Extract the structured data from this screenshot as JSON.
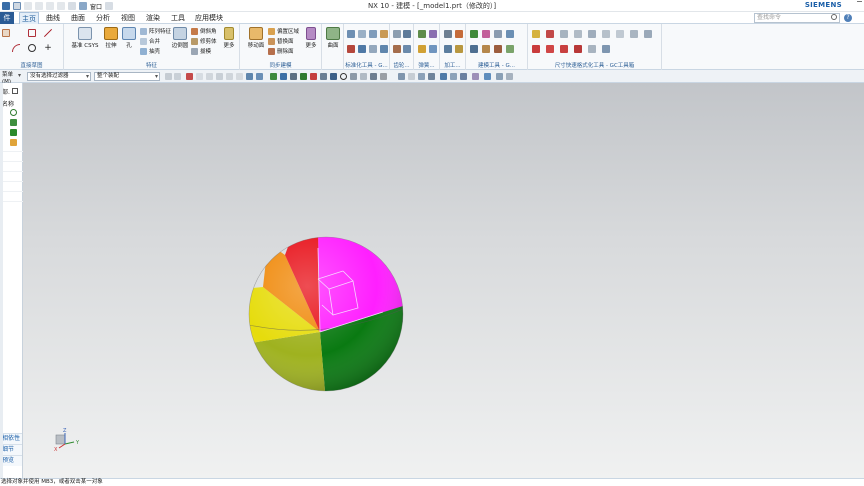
{
  "title": "NX 10 - 建模 - [_model1.prt（修改的）]",
  "brand": "SIEMENS",
  "file_tab": "件(F)",
  "menu_tabs": [
    "主页",
    "曲线",
    "曲面",
    "分析",
    "视图",
    "渲染",
    "工具",
    "应用模块"
  ],
  "active_tab": "主页",
  "search_placeholder": "查找命令",
  "quick_access": {
    "window_label": "窗口"
  },
  "ribbon": {
    "groups": [
      "直接草图",
      "特征",
      "同步建模",
      "标准化工具 - G...",
      "齿轮...",
      "弹簧...",
      "加工...",
      "建模工具 - G...",
      "尺寸快速格式化工具 - GC工具箱"
    ],
    "sketch_label": "草图",
    "datum_csys": "基准 CSYS",
    "extrude": "拉伸",
    "hole": "孔",
    "array_feature": "阵列特征",
    "unite": "合并",
    "shell": "抽壳",
    "edge_blend": "边倒圆",
    "chamfer": "倒斜角",
    "trim_body": "修剪体",
    "draft": "拔模",
    "more": "更多",
    "move_face": "移动面",
    "offset_region": "偏置区域",
    "replace_face": "替换面",
    "delete_face": "删除面",
    "surface": "曲面"
  },
  "filterbar": {
    "menu": "菜单(M)",
    "selection_filter": "没有选择过滤器",
    "assembly_scope": "整个装配"
  },
  "resource_bar": {
    "header": "部.",
    "name_col": "名称",
    "tabs": [
      "相依性",
      "细节",
      "预览"
    ]
  },
  "status": "选择对象并使用 MB3，或者双击某一对象",
  "triad_labels": {
    "x": "X",
    "y": "Y",
    "z": "Z"
  },
  "colors": {
    "accent": "#1b5fa8",
    "file_tab": "#2a5b95",
    "sphere_magenta": "#ff1fff",
    "sphere_red": "#e8121a",
    "sphere_orange": "#f08a0c",
    "sphere_yellow": "#e6dc0c",
    "sphere_olive": "#a0b021",
    "sphere_green": "#0a7a12"
  }
}
